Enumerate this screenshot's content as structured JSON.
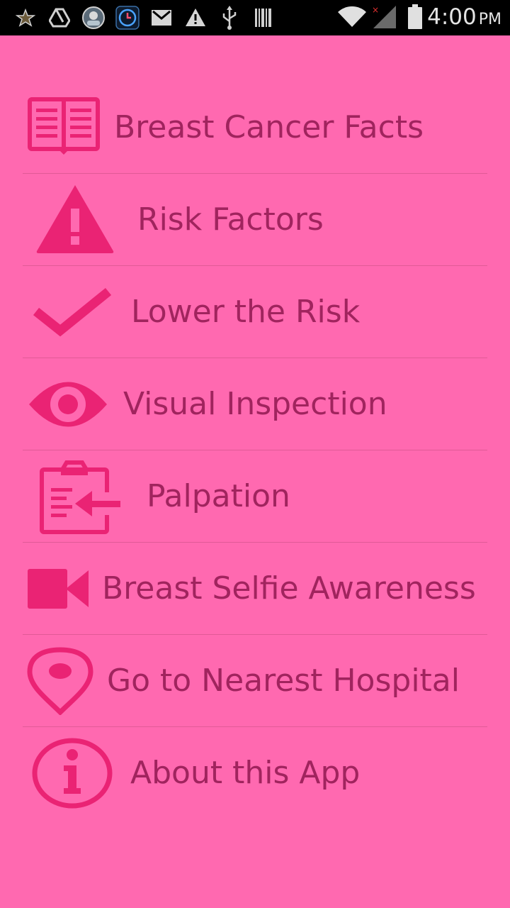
{
  "status_bar": {
    "time": "4:00",
    "ampm": "PM",
    "icons": [
      "star-notification-icon",
      "drive-icon",
      "avatar-notification-icon",
      "clock-app-icon",
      "gmail-icon",
      "warning-icon",
      "usb-icon",
      "barcode-icon",
      "wifi-icon",
      "signal-icon",
      "battery-icon"
    ]
  },
  "menu": {
    "items": [
      {
        "label": "Breast Cancer Facts",
        "icon": "open-book-icon"
      },
      {
        "label": "Risk Factors",
        "icon": "warning-triangle-icon"
      },
      {
        "label": "Lower the Risk",
        "icon": "checkmark-icon"
      },
      {
        "label": "Visual Inspection",
        "icon": "eye-icon"
      },
      {
        "label": "Palpation",
        "icon": "clipboard-arrow-icon"
      },
      {
        "label": "Breast Selfie Awareness",
        "icon": "video-camera-icon"
      },
      {
        "label": "Go to Nearest Hospital",
        "icon": "location-pin-icon"
      },
      {
        "label": "About this App",
        "icon": "info-icon"
      }
    ]
  },
  "colors": {
    "background": "#ff69b0",
    "icon": "#ea2374",
    "text": "#a0245e",
    "divider": "#e15a97",
    "status_bar": "#000000"
  }
}
